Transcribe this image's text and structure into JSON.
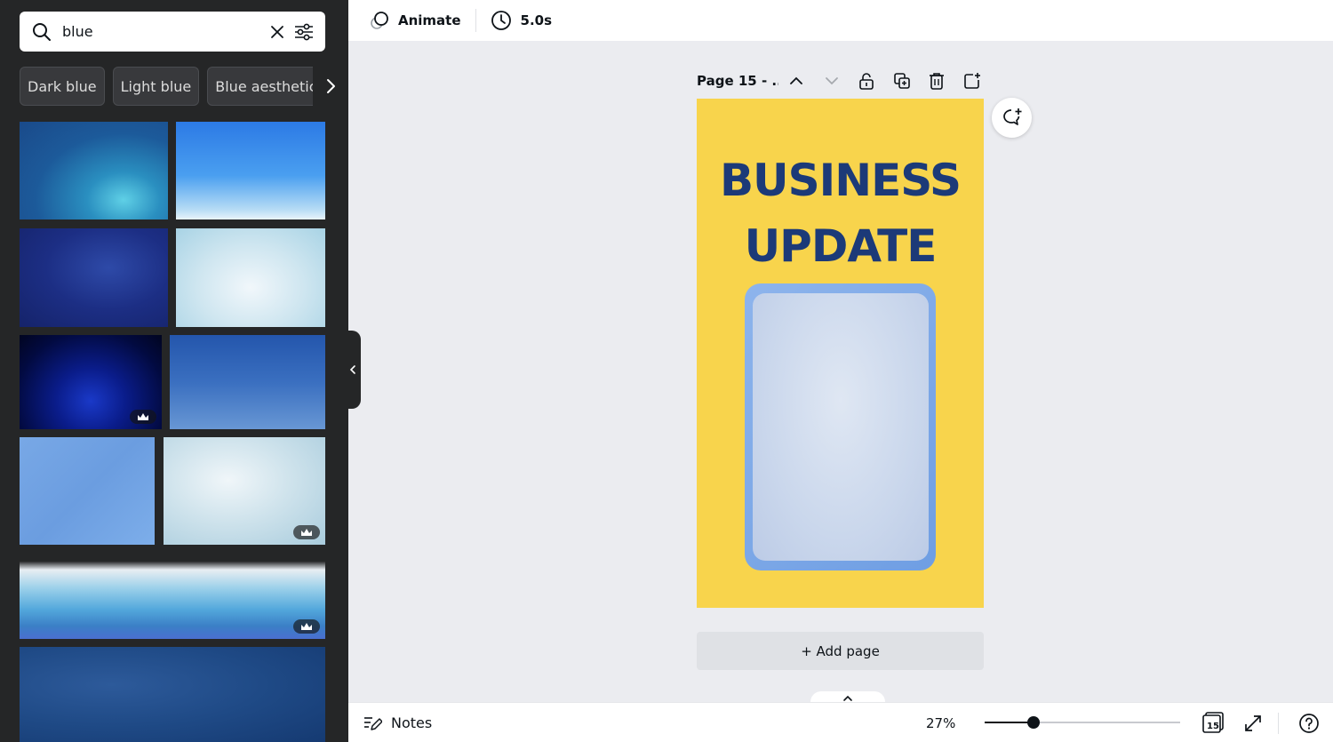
{
  "search": {
    "value": "blue"
  },
  "chips": [
    "Dark blue",
    "Light blue",
    "Blue aesthetic"
  ],
  "thumbnails": [
    {
      "name": "blue-watercolor",
      "premium": false
    },
    {
      "name": "blue-sky-gradient",
      "premium": false
    },
    {
      "name": "navy-fabric",
      "premium": false
    },
    {
      "name": "light-blue-clouds",
      "premium": false
    },
    {
      "name": "dark-blue-abstract",
      "premium": true
    },
    {
      "name": "blue-rain-texture",
      "premium": false
    },
    {
      "name": "light-blue-linen",
      "premium": false
    },
    {
      "name": "pale-blue-watercolor",
      "premium": true
    },
    {
      "name": "blue-waves-paint",
      "premium": true
    },
    {
      "name": "blue-brush-strokes",
      "premium": false
    }
  ],
  "toolbar": {
    "animate_label": "Animate",
    "duration_label": "5.0s"
  },
  "page": {
    "title": "Page 15 - ...",
    "headline_line1": "BUSINESS",
    "headline_line2": "UPDATE",
    "background_color": "#f8d44c",
    "headline_color": "#1c3a78"
  },
  "add_page_label": "+ Add page",
  "bottom": {
    "notes_label": "Notes",
    "zoom_label": "27%",
    "zoom_fraction": 0.25,
    "page_count": "15"
  }
}
